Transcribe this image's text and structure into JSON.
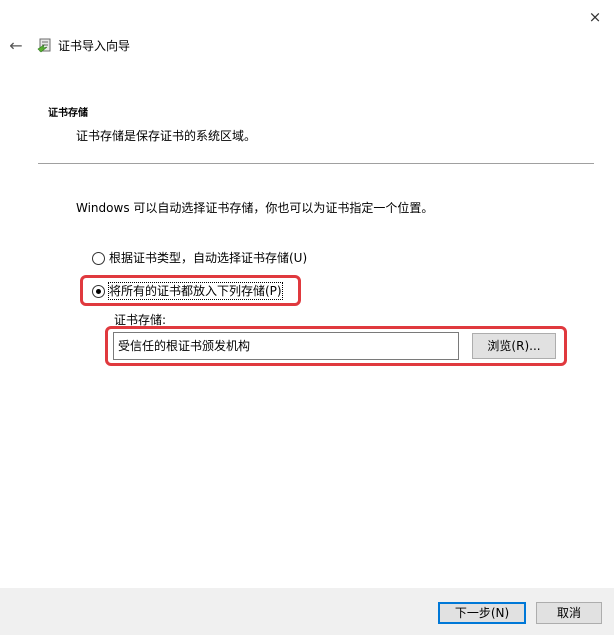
{
  "window": {
    "close_glyph": "×",
    "back_glyph": "←",
    "title": "证书导入向导"
  },
  "section": {
    "heading": "证书存储",
    "description": "证书存储是保存证书的系统区域。"
  },
  "main": {
    "info": "Windows 可以自动选择证书存储，你也可以为证书指定一个位置。",
    "options": [
      {
        "label": "根据证书类型，自动选择证书存储(U)",
        "selected": false
      },
      {
        "label": "将所有的证书都放入下列存储(P)",
        "selected": true
      }
    ],
    "store_label": "证书存储:",
    "store_value": "受信任的根证书颁发机构",
    "browse_label": "浏览(R)..."
  },
  "footer": {
    "next_label": "下一步(N)",
    "cancel_label": "取消"
  },
  "colors": {
    "highlight": "#e0393e",
    "footer_bg": "#f0f0f0",
    "accent": "#0078d7"
  },
  "icons": [
    "close-icon",
    "back-arrow-icon",
    "certificate-wizard-icon"
  ]
}
